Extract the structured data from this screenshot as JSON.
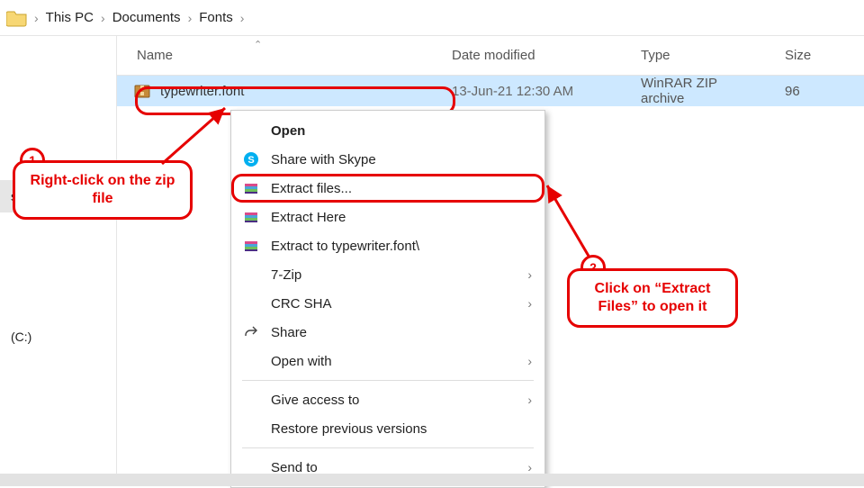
{
  "breadcrumb": {
    "items": [
      {
        "label": "This PC"
      },
      {
        "label": "Documents"
      },
      {
        "label": "Fonts"
      }
    ]
  },
  "sidebar": {
    "items": [
      {
        "label": "s"
      },
      {
        "label": ""
      },
      {
        "label": "(C:)"
      }
    ]
  },
  "columns": {
    "name": "Name",
    "date": "Date modified",
    "type": "Type",
    "size": "Size",
    "sort_indicator": "⌃"
  },
  "files": [
    {
      "name": "typewriter.font",
      "date": "13-Jun-21 12:30 AM",
      "type": "WinRAR ZIP archive",
      "size": "96"
    }
  ],
  "context_menu": {
    "open": "Open",
    "share_skype": "Share with Skype",
    "extract_files": "Extract files...",
    "extract_here": "Extract Here",
    "extract_to": "Extract to typewriter.font\\",
    "seven_zip": "7-Zip",
    "crc_sha": "CRC SHA",
    "share": "Share",
    "open_with": "Open with",
    "give_access": "Give access to",
    "restore": "Restore previous versions",
    "send_to": "Send to"
  },
  "annotations": {
    "step1_badge": "1",
    "step1_text": "Right-click on the zip file",
    "step2_badge": "2",
    "step2_text": "Click on “Extract Files” to open it"
  },
  "colors": {
    "accent_red": "#e60000",
    "selection_blue": "#cde8ff"
  }
}
